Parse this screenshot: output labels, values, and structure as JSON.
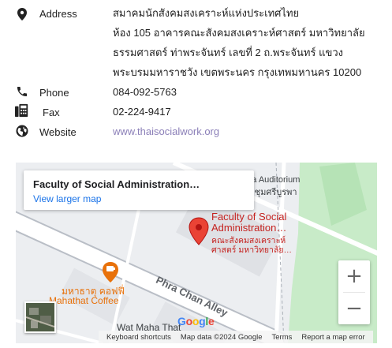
{
  "contact": {
    "address_label": "Address",
    "address_lines": [
      "สมาคมนักสังคมสงเคราะห์แห่งประเทศไทย",
      "ห้อง 105 อาคารคณะสังคมสงเคราะห์ศาสตร์ มหาวิทยาลัย",
      "ธรรมศาสตร์ ท่าพระจันทร์ เลขที่ 2 ถ.พระจันทร์ แขวง",
      "พระบรมมหาราชวัง เขตพระนคร กรุงเทพมหานคร 10200"
    ],
    "phone_label": "Phone",
    "phone_value": "084-092-5763",
    "fax_label": "Fax",
    "fax_value": "02-224-9417",
    "website_label": "Website",
    "website_value": "www.thaisocialwork.org",
    "icons": [
      "map-marker-icon",
      "phone-icon",
      "fax-icon",
      "globe-icon"
    ]
  },
  "map": {
    "card_title": "Faculty of Social Administration…",
    "card_link": "View larger map",
    "poi_auditorium_en": "ourapha Auditorium",
    "poi_auditorium_th": "หอประชุมศรีบูรพา",
    "poi_faculty_en_1": "Faculty of Social",
    "poi_faculty_en_2": "Administration…",
    "poi_faculty_th_1": "คณะสังคมสงเคราะห์",
    "poi_faculty_th_2": "ศาสตร์ มหาวิทยาลัย…",
    "poi_cafe_th": "มหาธาตุ คอฟฟี่",
    "poi_cafe_en": "Mahathat Coffee",
    "road_label": "Phra Chan Alley",
    "poi_bottom": "Wat Maha That",
    "google_letters": [
      "G",
      "o",
      "o",
      "g",
      "l",
      "e"
    ],
    "google_colors": [
      "#4285F4",
      "#EA4335",
      "#FBBC05",
      "#4285F4",
      "#34A853",
      "#EA4335"
    ],
    "zoom_in": "+",
    "zoom_out": "−",
    "attrib_shortcuts": "Keyboard shortcuts",
    "attrib_data": "Map data ©2024 Google",
    "attrib_terms": "Terms",
    "attrib_report": "Report a map error",
    "marker_color": "#ea4335",
    "poi_text_color": "#c5221f",
    "cafe_color": "#e8710a"
  }
}
